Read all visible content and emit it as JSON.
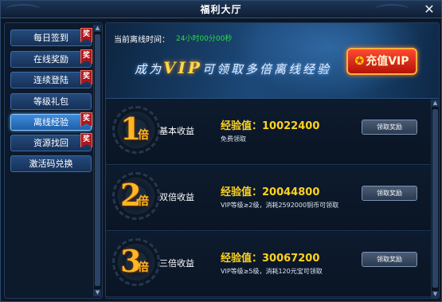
{
  "window": {
    "title": "福利大厅"
  },
  "sidebar": {
    "items": [
      {
        "label": "每日签到",
        "badge": "奖"
      },
      {
        "label": "在线奖励",
        "badge": "奖"
      },
      {
        "label": "连续登陆",
        "badge": "奖"
      },
      {
        "label": "等级礼包",
        "badge": ""
      },
      {
        "label": "离线经验",
        "badge": "奖",
        "active": true
      },
      {
        "label": "资源找回",
        "badge": "奖"
      },
      {
        "label": "激活码兑换",
        "badge": ""
      }
    ]
  },
  "banner": {
    "offline_label": "当前离线时间：",
    "offline_time": "24小时00分00秒",
    "slogan_before": "成为",
    "slogan_vip": "VIP",
    "slogan_after": "可领取多倍离线经验",
    "recharge_label": "充值VIP"
  },
  "rewards": [
    {
      "multiplier": "1",
      "unit": "倍",
      "type": "基本收益",
      "exp": "经验值：10022400",
      "condition": "免费领取",
      "button": "领取奖励"
    },
    {
      "multiplier": "2",
      "unit": "倍",
      "type": "双倍收益",
      "exp": "经验值：20044800",
      "condition": "VIP等级≥2级，消耗2592000铜币可领取",
      "button": "领取奖励"
    },
    {
      "multiplier": "3",
      "unit": "倍",
      "type": "三倍收益",
      "exp": "经验值：30067200",
      "condition": "VIP等级≥5级，消耗120元宝可领取",
      "button": "领取奖励"
    }
  ],
  "colors": {
    "accent": "#ffd31f",
    "time": "#25e13b",
    "badge": "#b0141a"
  },
  "icons": {
    "close": "close-icon",
    "badge": "reward-badge-icon",
    "scroll_up": "scroll-up-icon",
    "scroll_down": "scroll-down-icon",
    "coin": "coin-icon"
  }
}
